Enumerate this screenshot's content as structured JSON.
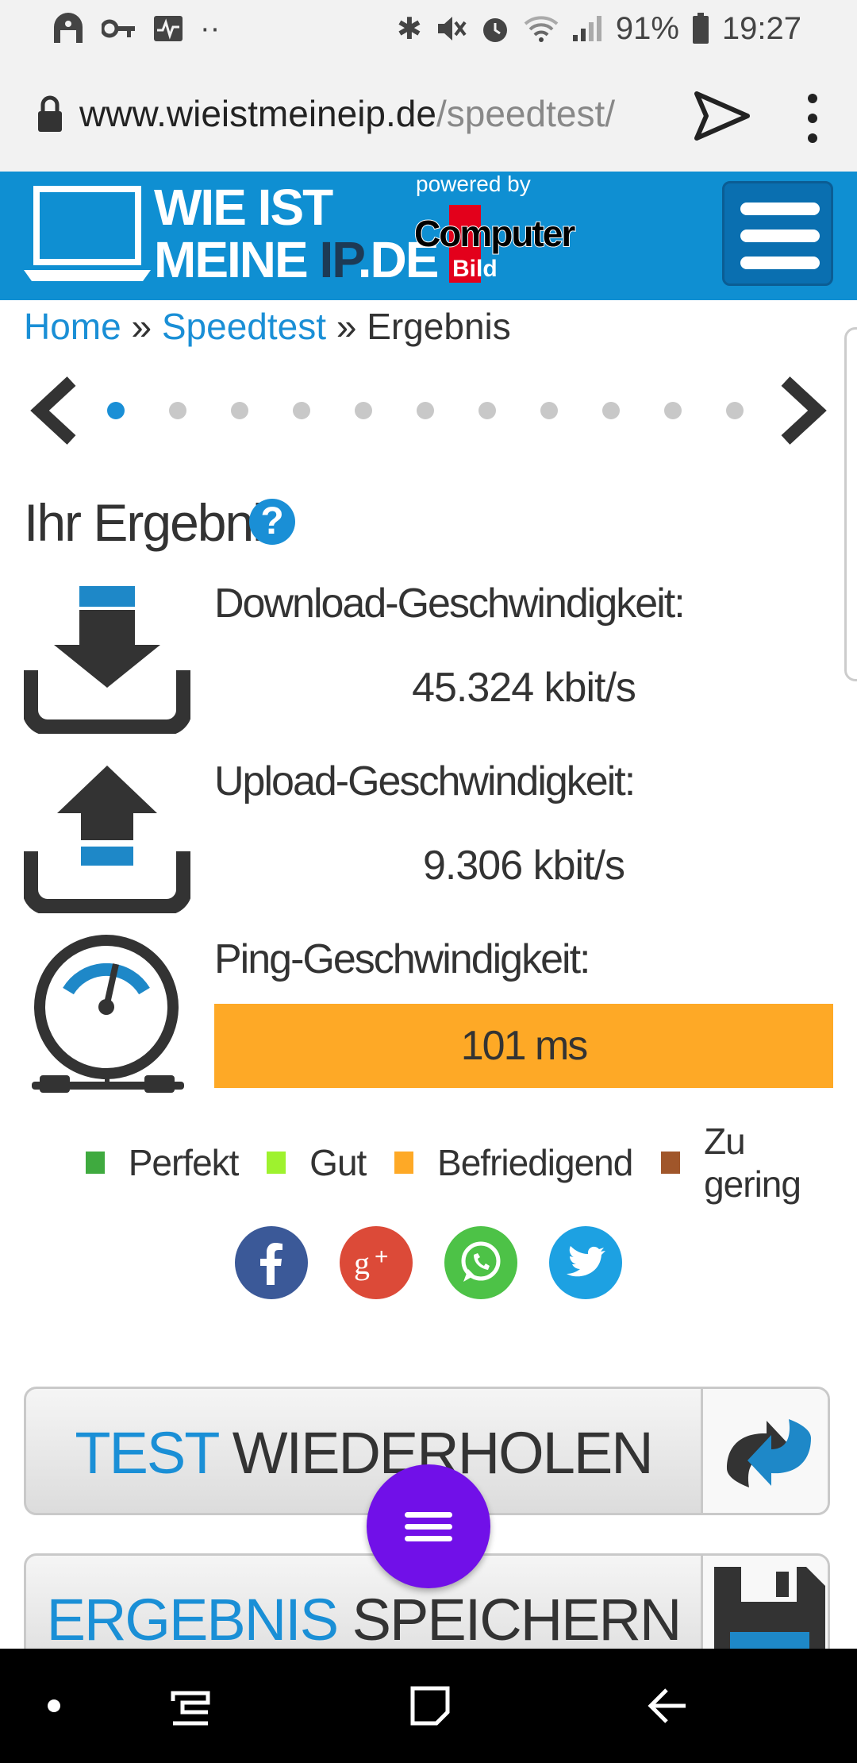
{
  "status_bar": {
    "battery": "91%",
    "time": "19:27",
    "dots": "··"
  },
  "browser": {
    "url_domain": "www.wieistmeineip.de",
    "url_path": "/speedtest/"
  },
  "header": {
    "logo_line1": "WIE IST",
    "logo_line2_a": "MEINE ",
    "logo_line2_b": "IP",
    "logo_line2_c": ".DE",
    "powered_by": "powered by",
    "partner_name": "Computer",
    "partner_sub": "Bild"
  },
  "breadcrumb": {
    "home": "Home",
    "sep1": " » ",
    "speedtest": "Speedtest",
    "sep2": " » ",
    "current": "Ergebnis"
  },
  "carousel": {
    "dot_count": 11,
    "active_index": 0
  },
  "result": {
    "heading": "Ihr Ergebnis",
    "help": "?",
    "download_label": "Download-Geschwindigkeit:",
    "download_value": "45.324 kbit/s",
    "upload_label": "Upload-Geschwindigkeit:",
    "upload_value": "9.306 kbit/s",
    "ping_label": "Ping-Geschwindigkeit:",
    "ping_value": "101 ms"
  },
  "legend": [
    {
      "label": "Perfekt",
      "color": "#3faa3f"
    },
    {
      "label": "Gut",
      "color": "#9ef22e"
    },
    {
      "label": "Befriedigend",
      "color": "#fea926"
    },
    {
      "label": "Zu gering",
      "color": "#a0562a"
    }
  ],
  "social": {
    "facebook_color": "#3b5998",
    "gplus_color": "#dc4a38",
    "whatsapp_color": "#4dc247",
    "twitter_color": "#1da1e2"
  },
  "buttons": {
    "retest_hl": "TEST",
    "retest_rest": " WIEDERHOLEN",
    "save_hl": "ERGEBNIS",
    "save_rest": " SPEICHERN"
  },
  "colors": {
    "brand": "#0f8fd2",
    "link": "#1a8fd6",
    "fab": "#7110e8"
  }
}
